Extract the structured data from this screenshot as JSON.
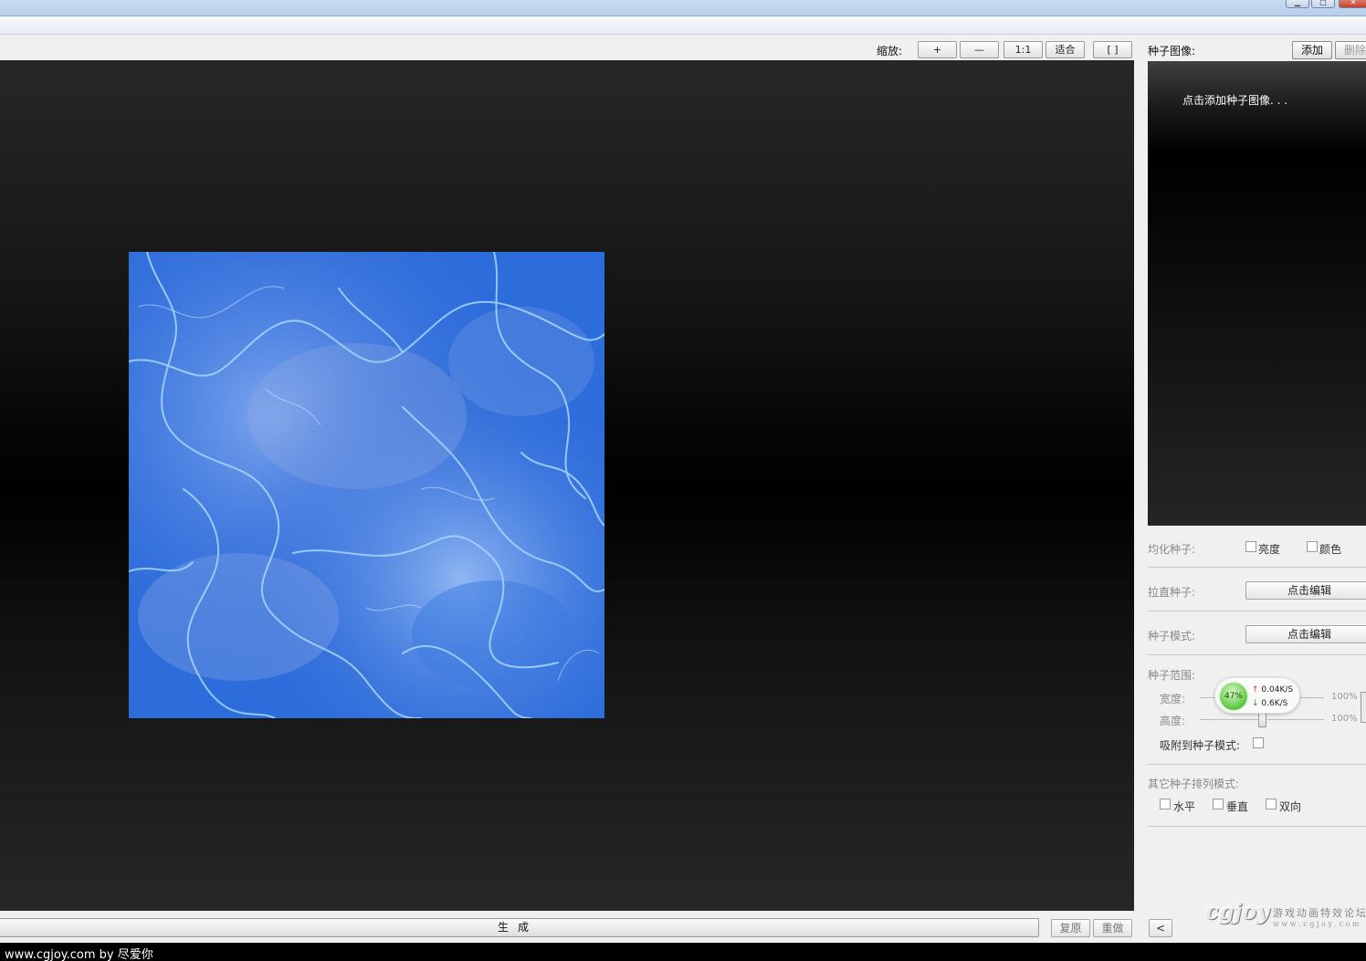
{
  "window": {
    "buttons": {
      "minimize": "▁",
      "maximize": "□",
      "close": "✕"
    }
  },
  "toolbar": {
    "zoom_label": "缩放:",
    "zoom_in": "+",
    "zoom_out": "—",
    "actual_size": "1:1",
    "fit": "适合",
    "bracket": "[ ]"
  },
  "seed_panel": {
    "label": "种子图像:",
    "add_button": "添加",
    "delete_button": "删除",
    "hint": "点击添加种子图像. . ."
  },
  "equalize": {
    "label": "均化种子:",
    "brightness": "亮度",
    "color": "颜色"
  },
  "straighten": {
    "label": "拉直种子:",
    "button": "点击编辑"
  },
  "seed_mode": {
    "label": "种子模式:",
    "button": "点击编辑"
  },
  "seed_range": {
    "label": "种子范围:",
    "width_label": "宽度:",
    "width_value": "100%",
    "height_label": "高度:",
    "height_value": "100%",
    "snap_label": "吸附到种子模式:"
  },
  "other_layout": {
    "label": "其它种子排列模式:",
    "horizontal": "水平",
    "vertical": "垂直",
    "both": "双向"
  },
  "bottom": {
    "generate": "生成",
    "undo": "复原",
    "redo": "重做",
    "collapse": "<"
  },
  "net_monitor": {
    "percent": "47%",
    "upload": "0.04K/S",
    "download": "0.6K/S"
  },
  "logo": {
    "mark": "cgjoy",
    "tagline": "游戏动画特效论坛",
    "url": "w w w . c g j o y . c o m"
  },
  "watermark": "www.cgjoy.com by 尽爱你",
  "colors": {
    "texture_base": "#2d6fdc",
    "texture_vein": "#a9d6ff"
  }
}
